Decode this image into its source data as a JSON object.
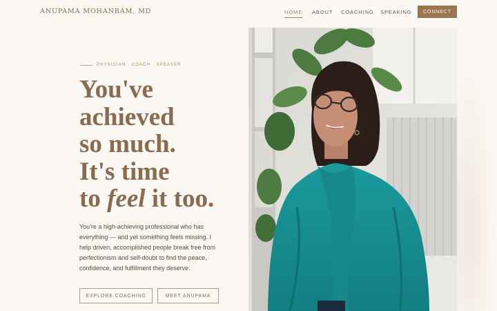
{
  "brand": "ANUPAMA MOHANRAM, MD",
  "nav": {
    "items": [
      "HOME",
      "ABOUT",
      "COACHING",
      "SPEAKING"
    ],
    "active": "HOME",
    "cta": "CONNECT"
  },
  "hero": {
    "eyebrow": "PHYSICIAN · COACH · SPEAKER",
    "headline": {
      "line1": "You've",
      "line2": "achieved",
      "line3": "so much.",
      "line4": "It's time",
      "line5_pre": "to ",
      "line5_em": "feel",
      "line5_post": " it too."
    },
    "body": "You're a high-achieving professional who has everything — and yet something feels missing. I help driven, accomplished people break free from perfectionism and self-doubt to find the peace, confidence, and fulfillment they deserve.",
    "buttons": {
      "primary": "EXPLORE COACHING",
      "secondary": "MEET ANUPAMA"
    }
  },
  "colors": {
    "background": "#fcf8f3",
    "accent": "#9c7551",
    "headline": "#8a6b4e",
    "text": "#5b4a3b"
  }
}
